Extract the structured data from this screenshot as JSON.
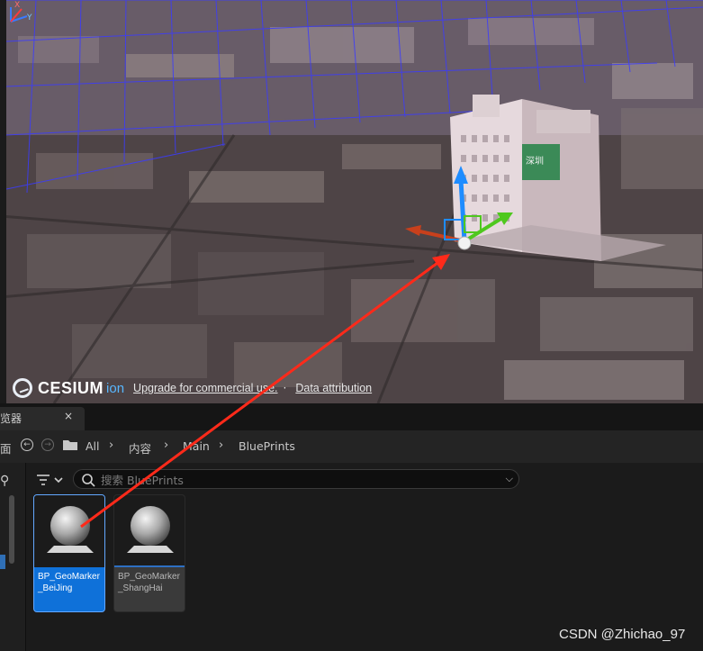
{
  "viewport": {
    "cesium_brand": "CESIUM",
    "cesium_ion": "ion",
    "credit_upgrade_link": "Upgrade for commercial use.",
    "credit_separator": "·",
    "credit_attribution_link": "Data attribution",
    "axis_labels": {
      "x": "X",
      "y": "Y",
      "z": "Z"
    },
    "billboard_text": "深圳"
  },
  "content_browser": {
    "tab_title": "览器",
    "tab_close": "×",
    "nav": {
      "left_fragment": "面",
      "breadcrumbs": [
        "All",
        "内容",
        "Main",
        "BluePrints"
      ]
    },
    "search": {
      "placeholder": "搜索 BluePrints",
      "value": ""
    },
    "assets": [
      {
        "label": "BP_GeoMarker_BeiJing",
        "selected": true
      },
      {
        "label": "BP_GeoMarker_ShangHai",
        "selected": false
      }
    ]
  },
  "watermark": "CSDN @Zhichao_97",
  "icons": {
    "back": "back-arrow-icon",
    "forward": "forward-arrow-icon",
    "folder": "folder-icon",
    "filter": "filter-icon",
    "search": "search-icon",
    "sphere": "sphere-icon"
  },
  "colors": {
    "selection_blue": "#0f71d9",
    "annotation_arrow": "#ff2a1a",
    "gizmo_z": "#1e8cff",
    "gizmo_x": "#c8401c",
    "gizmo_y": "#4fc81e"
  }
}
